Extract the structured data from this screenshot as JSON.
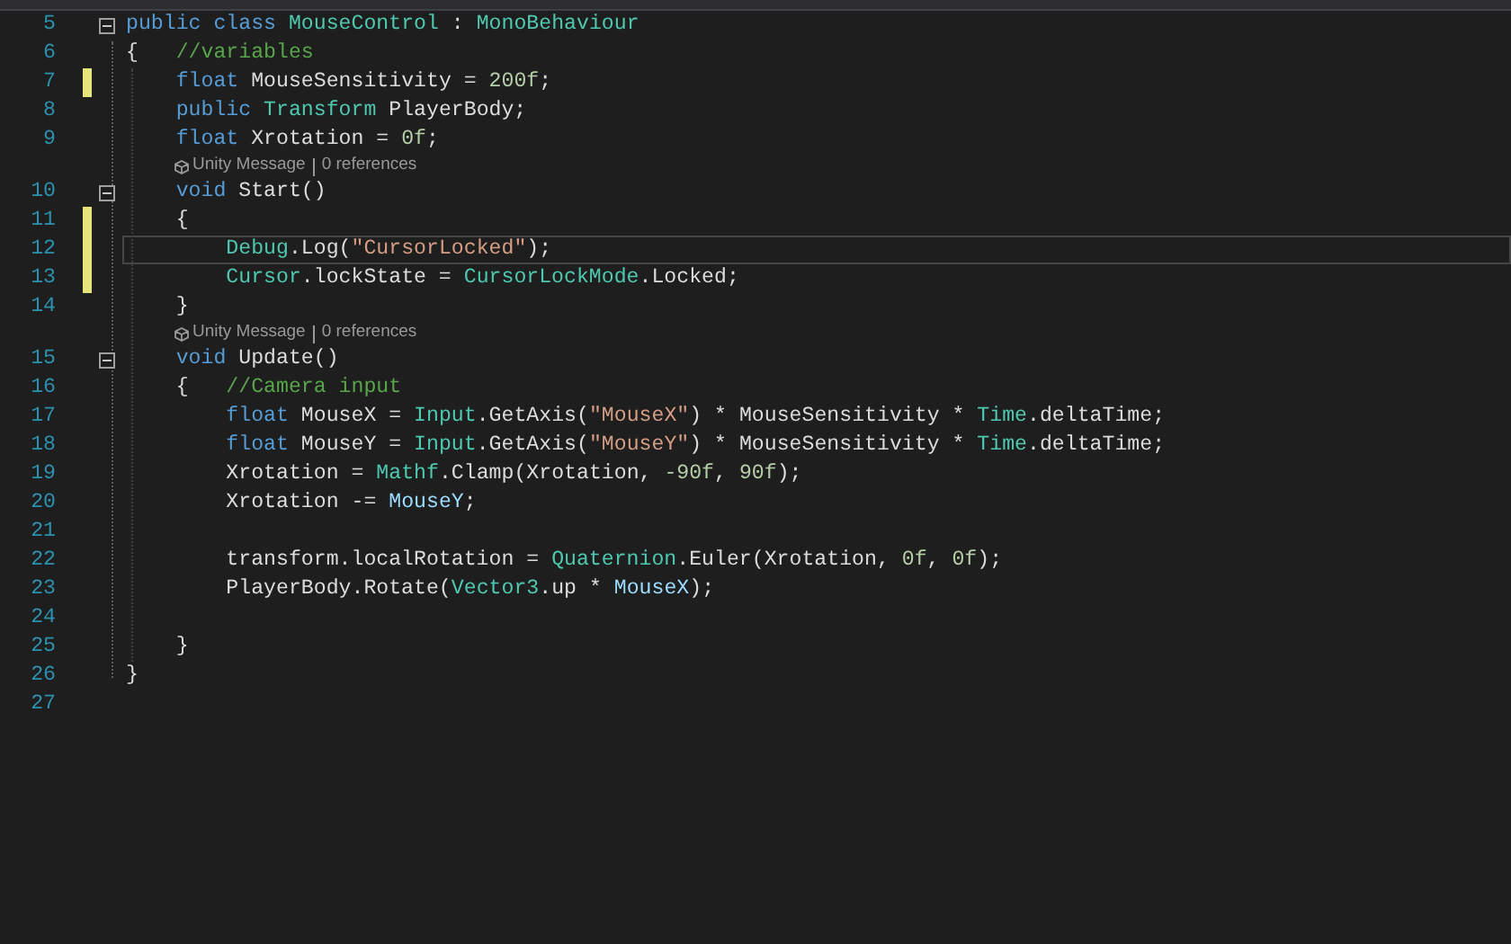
{
  "editor": {
    "lines": [
      {
        "kind": "code",
        "number": "5",
        "fold": true,
        "changed": false,
        "current": false,
        "tokens": [
          {
            "kind": "keyword",
            "text": "public"
          },
          {
            "kind": "keyword",
            "text": " class"
          },
          {
            "kind": "type",
            "text": " MouseControl"
          },
          {
            "kind": "plain",
            "text": " : "
          },
          {
            "kind": "type",
            "text": "MonoBehaviour"
          }
        ]
      },
      {
        "kind": "code",
        "number": "6",
        "fold": false,
        "changed": false,
        "current": false,
        "tokens": [
          {
            "kind": "plain",
            "text": "{   "
          },
          {
            "kind": "comment",
            "text": "//variables"
          }
        ]
      },
      {
        "kind": "code",
        "number": "7",
        "fold": false,
        "changed": true,
        "current": false,
        "tokens": [
          {
            "kind": "keyword",
            "text": "    float"
          },
          {
            "kind": "plain",
            "text": " MouseSensitivity = "
          },
          {
            "kind": "number",
            "text": "200f"
          },
          {
            "kind": "plain",
            "text": ";"
          }
        ]
      },
      {
        "kind": "code",
        "number": "8",
        "fold": false,
        "changed": false,
        "current": false,
        "tokens": [
          {
            "kind": "keyword",
            "text": "    public"
          },
          {
            "kind": "type",
            "text": " Transform"
          },
          {
            "kind": "plain",
            "text": " PlayerBody;"
          }
        ]
      },
      {
        "kind": "code",
        "number": "9",
        "fold": false,
        "changed": false,
        "current": false,
        "tokens": [
          {
            "kind": "keyword",
            "text": "    float"
          },
          {
            "kind": "plain",
            "text": " Xrotation = "
          },
          {
            "kind": "number",
            "text": "0f"
          },
          {
            "kind": "plain",
            "text": ";"
          }
        ]
      },
      {
        "kind": "codelens",
        "parts": [
          "Unity Message",
          "0 references"
        ]
      },
      {
        "kind": "code",
        "number": "10",
        "fold": true,
        "changed": false,
        "current": false,
        "tokens": [
          {
            "kind": "keyword",
            "text": "    void"
          },
          {
            "kind": "plain",
            "text": " Start()"
          }
        ]
      },
      {
        "kind": "code",
        "number": "11",
        "fold": false,
        "changed": true,
        "current": false,
        "tokens": [
          {
            "kind": "plain",
            "text": "    {"
          }
        ]
      },
      {
        "kind": "code",
        "number": "12",
        "fold": false,
        "changed": true,
        "current": true,
        "tokens": [
          {
            "kind": "type",
            "text": "        Debug"
          },
          {
            "kind": "plain",
            "text": ".Log("
          },
          {
            "kind": "string",
            "text": "\"CursorLocked\""
          },
          {
            "kind": "plain",
            "text": ");"
          }
        ]
      },
      {
        "kind": "code",
        "number": "13",
        "fold": false,
        "changed": true,
        "current": false,
        "tokens": [
          {
            "kind": "type",
            "text": "        Cursor"
          },
          {
            "kind": "plain",
            "text": ".lockState = "
          },
          {
            "kind": "type",
            "text": "CursorLockMode"
          },
          {
            "kind": "plain",
            "text": ".Locked;"
          }
        ]
      },
      {
        "kind": "code",
        "number": "14",
        "fold": false,
        "changed": false,
        "current": false,
        "tokens": [
          {
            "kind": "plain",
            "text": "    }"
          }
        ]
      },
      {
        "kind": "codelens",
        "parts": [
          "Unity Message",
          "0 references"
        ]
      },
      {
        "kind": "code",
        "number": "15",
        "fold": true,
        "changed": false,
        "current": false,
        "tokens": [
          {
            "kind": "keyword",
            "text": "    void"
          },
          {
            "kind": "plain",
            "text": " Update()"
          }
        ]
      },
      {
        "kind": "code",
        "number": "16",
        "fold": false,
        "changed": false,
        "current": false,
        "tokens": [
          {
            "kind": "plain",
            "text": "    {   "
          },
          {
            "kind": "comment",
            "text": "//Camera input"
          }
        ]
      },
      {
        "kind": "code",
        "number": "17",
        "fold": false,
        "changed": false,
        "current": false,
        "tokens": [
          {
            "kind": "keyword",
            "text": "        float"
          },
          {
            "kind": "plain",
            "text": " MouseX = "
          },
          {
            "kind": "type",
            "text": "Input"
          },
          {
            "kind": "plain",
            "text": ".GetAxis("
          },
          {
            "kind": "string",
            "text": "\"MouseX\""
          },
          {
            "kind": "plain",
            "text": ") * MouseSensitivity * "
          },
          {
            "kind": "type",
            "text": "Time"
          },
          {
            "kind": "plain",
            "text": ".deltaTime;"
          }
        ]
      },
      {
        "kind": "code",
        "number": "18",
        "fold": false,
        "changed": false,
        "current": false,
        "tokens": [
          {
            "kind": "keyword",
            "text": "        float"
          },
          {
            "kind": "plain",
            "text": " MouseY = "
          },
          {
            "kind": "type",
            "text": "Input"
          },
          {
            "kind": "plain",
            "text": ".GetAxis("
          },
          {
            "kind": "string",
            "text": "\"MouseY\""
          },
          {
            "kind": "plain",
            "text": ") * MouseSensitivity * "
          },
          {
            "kind": "type",
            "text": "Time"
          },
          {
            "kind": "plain",
            "text": ".deltaTime;"
          }
        ]
      },
      {
        "kind": "code",
        "number": "19",
        "fold": false,
        "changed": false,
        "current": false,
        "tokens": [
          {
            "kind": "plain",
            "text": "        Xrotation = "
          },
          {
            "kind": "type",
            "text": "Mathf"
          },
          {
            "kind": "plain",
            "text": ".Clamp(Xrotation, "
          },
          {
            "kind": "number",
            "text": "-90f"
          },
          {
            "kind": "plain",
            "text": ", "
          },
          {
            "kind": "number",
            "text": "90f"
          },
          {
            "kind": "plain",
            "text": ");"
          }
        ]
      },
      {
        "kind": "code",
        "number": "20",
        "fold": false,
        "changed": false,
        "current": false,
        "tokens": [
          {
            "kind": "plain",
            "text": "        Xrotation -= "
          },
          {
            "kind": "variable",
            "text": "MouseY"
          },
          {
            "kind": "plain",
            "text": ";"
          }
        ]
      },
      {
        "kind": "code",
        "number": "21",
        "fold": false,
        "changed": false,
        "current": false
      },
      {
        "kind": "code",
        "number": "22",
        "fold": false,
        "changed": false,
        "current": false,
        "tokens": [
          {
            "kind": "plain",
            "text": "        transform.localRotation = "
          },
          {
            "kind": "type",
            "text": "Quaternion"
          },
          {
            "kind": "plain",
            "text": ".Euler(Xrotation, "
          },
          {
            "kind": "number",
            "text": "0f"
          },
          {
            "kind": "plain",
            "text": ", "
          },
          {
            "kind": "number",
            "text": "0f"
          },
          {
            "kind": "plain",
            "text": ");"
          }
        ]
      },
      {
        "kind": "code",
        "number": "23",
        "fold": false,
        "changed": false,
        "current": false,
        "tokens": [
          {
            "kind": "plain",
            "text": "        PlayerBody.Rotate("
          },
          {
            "kind": "type",
            "text": "Vector3"
          },
          {
            "kind": "plain",
            "text": ".up * "
          },
          {
            "kind": "variable",
            "text": "MouseX"
          },
          {
            "kind": "plain",
            "text": ");"
          }
        ]
      },
      {
        "kind": "code",
        "number": "24",
        "fold": false,
        "changed": false,
        "current": false
      },
      {
        "kind": "code",
        "number": "25",
        "fold": false,
        "changed": false,
        "current": false,
        "tokens": [
          {
            "kind": "plain",
            "text": "    }"
          }
        ]
      },
      {
        "kind": "code",
        "number": "26",
        "fold": false,
        "changed": false,
        "current": false,
        "tokens": [
          {
            "kind": "plain",
            "text": "}"
          }
        ]
      },
      {
        "kind": "code",
        "number": "27",
        "fold": false,
        "changed": false,
        "current": false
      }
    ]
  }
}
